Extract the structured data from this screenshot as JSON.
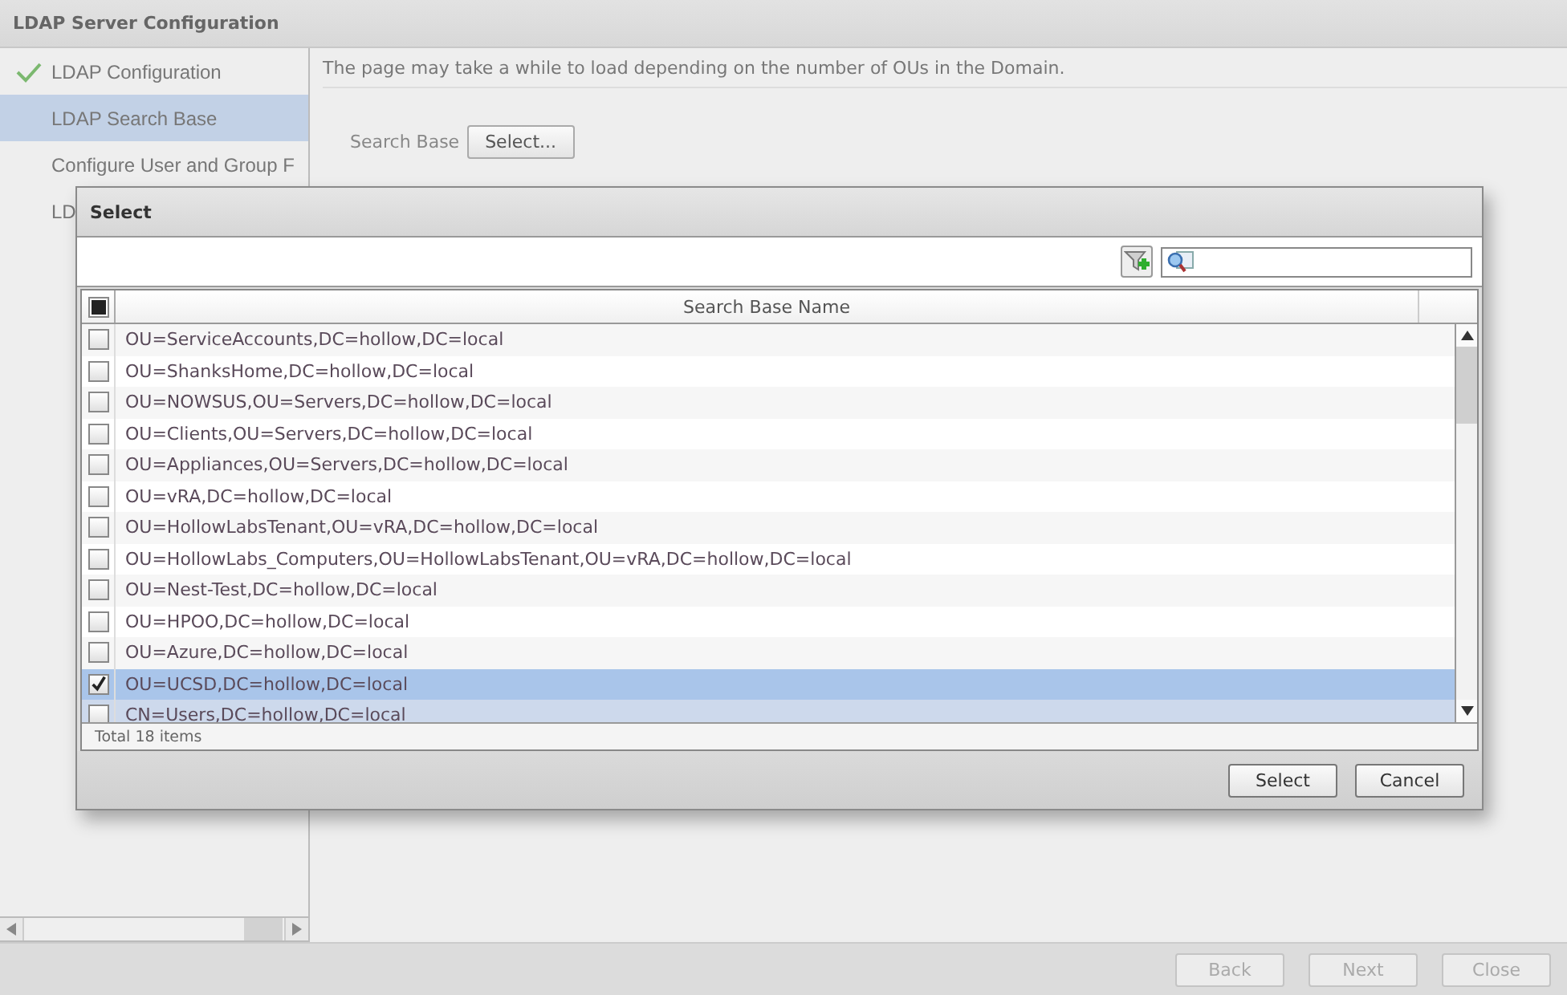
{
  "window": {
    "title": "LDAP Server Configuration"
  },
  "sidebar": {
    "items": [
      {
        "label": "LDAP Configuration",
        "done": true,
        "selected": false
      },
      {
        "label": "LDAP Search Base",
        "done": false,
        "selected": true
      },
      {
        "label": "Configure User and Group F",
        "done": false,
        "selected": false
      },
      {
        "label": "LD",
        "done": false,
        "selected": false
      }
    ]
  },
  "content": {
    "message": "The page may take a while to load depending on the number of OUs in the Domain.",
    "search_base_label": "Search Base",
    "select_button": "Select..."
  },
  "dialog": {
    "title": "Select",
    "header_checkbox": {
      "indeterminate": true
    },
    "column": "Search Base Name",
    "rows": [
      {
        "name": "OU=ServiceAccounts,DC=hollow,DC=local",
        "checked": false,
        "selected": false,
        "hover": false
      },
      {
        "name": "OU=ShanksHome,DC=hollow,DC=local",
        "checked": false,
        "selected": false,
        "hover": false
      },
      {
        "name": "OU=NOWSUS,OU=Servers,DC=hollow,DC=local",
        "checked": false,
        "selected": false,
        "hover": false
      },
      {
        "name": "OU=Clients,OU=Servers,DC=hollow,DC=local",
        "checked": false,
        "selected": false,
        "hover": false
      },
      {
        "name": "OU=Appliances,OU=Servers,DC=hollow,DC=local",
        "checked": false,
        "selected": false,
        "hover": false
      },
      {
        "name": "OU=vRA,DC=hollow,DC=local",
        "checked": false,
        "selected": false,
        "hover": false
      },
      {
        "name": "OU=HollowLabsTenant,OU=vRA,DC=hollow,DC=local",
        "checked": false,
        "selected": false,
        "hover": false
      },
      {
        "name": "OU=HollowLabs_Computers,OU=HollowLabsTenant,OU=vRA,DC=hollow,DC=local",
        "checked": false,
        "selected": false,
        "hover": false
      },
      {
        "name": "OU=Nest-Test,DC=hollow,DC=local",
        "checked": false,
        "selected": false,
        "hover": false
      },
      {
        "name": "OU=HPOO,DC=hollow,DC=local",
        "checked": false,
        "selected": false,
        "hover": false
      },
      {
        "name": "OU=Azure,DC=hollow,DC=local",
        "checked": false,
        "selected": false,
        "hover": false
      },
      {
        "name": "OU=UCSD,DC=hollow,DC=local",
        "checked": true,
        "selected": true,
        "hover": false
      },
      {
        "name": "CN=Users,DC=hollow,DC=local",
        "checked": false,
        "selected": false,
        "hover": true
      }
    ],
    "total": "Total 18 items",
    "buttons": [
      "Select",
      "Cancel"
    ]
  },
  "footer": {
    "buttons": [
      {
        "label": "Back",
        "disabled": true
      },
      {
        "label": "Next",
        "disabled": true
      },
      {
        "label": "Close",
        "disabled": true
      }
    ]
  }
}
